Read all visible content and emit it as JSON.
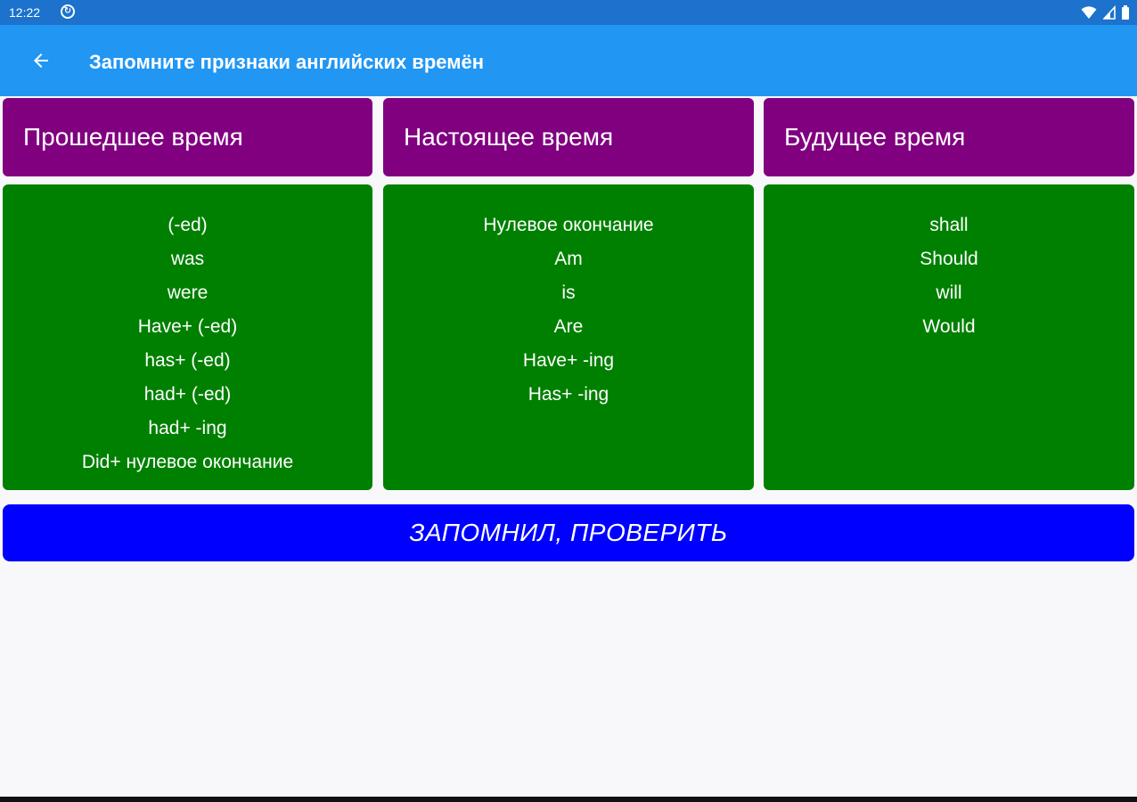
{
  "status_bar": {
    "time": "12:22",
    "notification_icon": "sync-icon",
    "wifi_icon": "wifi-icon",
    "signal_icon": "signal-icon",
    "battery_icon": "battery-icon"
  },
  "app_bar": {
    "back_icon": "arrow-back-icon",
    "title": "Запомните признаки английских времён",
    "color": "#2196f3"
  },
  "columns": [
    {
      "title": "Прошедшее время",
      "items": [
        "(-ed)",
        "was",
        "were",
        "Have+ (-ed)",
        "has+ (-ed)",
        "had+ (-ed)",
        "had+ -ing",
        "Did+ нулевое окончание"
      ]
    },
    {
      "title": "Настоящее время",
      "items": [
        "Нулевое окончание",
        "Am",
        "is",
        "Are",
        "Have+ -ing",
        "Has+ -ing"
      ]
    },
    {
      "title": "Будущее время",
      "items": [
        "shall",
        "Should",
        "will",
        "Would"
      ]
    }
  ],
  "colors": {
    "header_card": "#800080",
    "body_card": "#008000",
    "button": "#0000ff"
  },
  "check_button": {
    "label": "ЗАПОМНИЛ, ПРОВЕРИТЬ"
  }
}
